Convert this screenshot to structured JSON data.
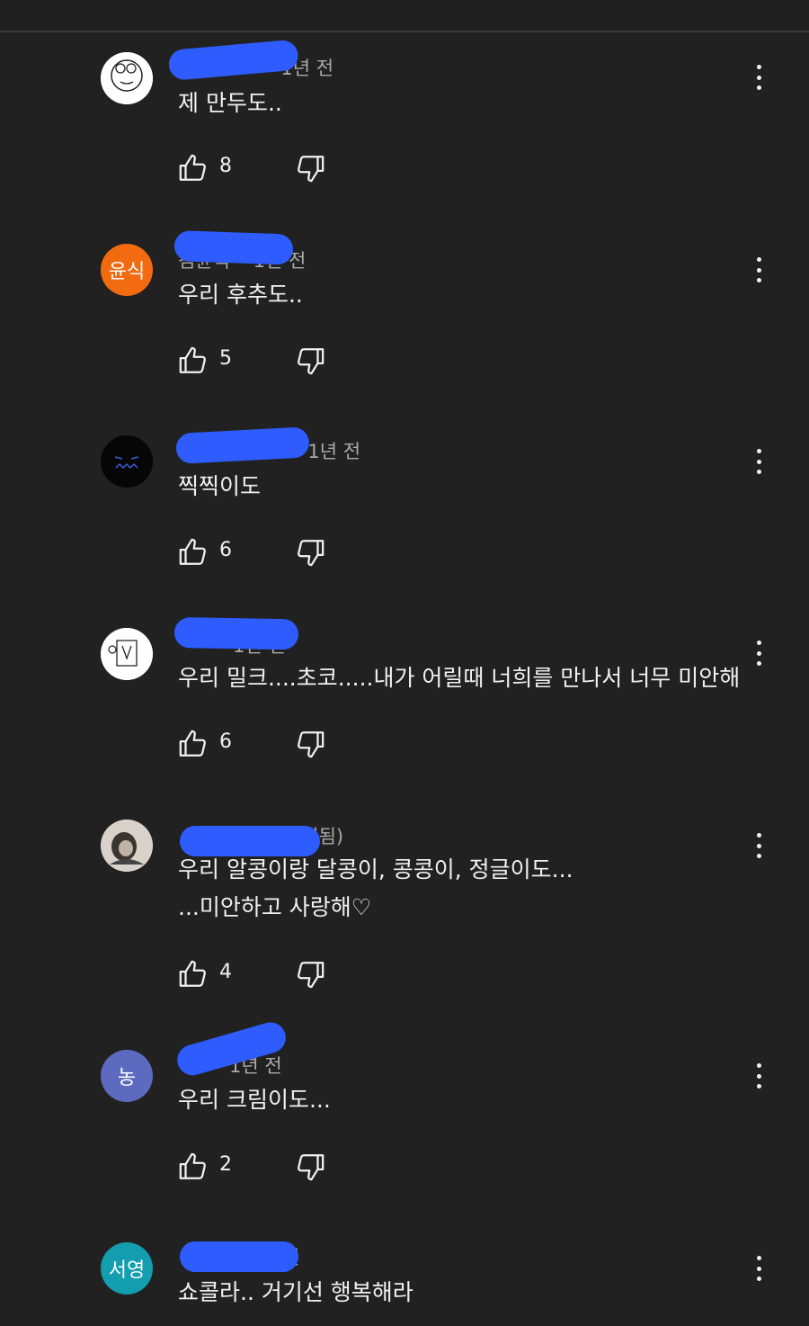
{
  "comments": [
    {
      "meta_visible": "•1년 전",
      "text": "제 만두도..",
      "likes": "8",
      "avatar_kind": "drawing",
      "avatar_letters": ""
    },
    {
      "meta_visible": "김윤식 • 1년 전",
      "text": "우리 후추도..",
      "likes": "5",
      "avatar_kind": "letter",
      "avatar_letters": "윤식",
      "avatar_color": "#f26b11"
    },
    {
      "meta_visible": "•1년 전",
      "text": "찍찍이도",
      "likes": "6",
      "avatar_kind": "dark",
      "avatar_letters": ""
    },
    {
      "meta_visible": "• 1년 전",
      "text": "우리 밀크....초코.....내가 어릴때 너희를 만나서 너무 미안해",
      "likes": "6",
      "avatar_kind": "drawing2",
      "avatar_letters": ""
    },
    {
      "meta_visible": "• 1년 전(수정됨)",
      "text": "우리 알콩이랑 달콩이, 콩콩이, 정글이도...\n...미안하고 사랑해♡",
      "likes": "4",
      "avatar_kind": "photo",
      "avatar_letters": ""
    },
    {
      "meta_visible": "• 1년 전",
      "text": "우리 크림이도...",
      "likes": "2",
      "avatar_kind": "letter",
      "avatar_letters": "농",
      "avatar_color": "#5c6bc0"
    },
    {
      "meta_visible": "전",
      "text": "쇼콜라.. 거기선 행복해라",
      "likes": "",
      "avatar_kind": "letter",
      "avatar_letters": "서영",
      "avatar_color": "#129eaf"
    }
  ],
  "colors": {
    "redaction": "#2e5cff",
    "background": "#212121"
  },
  "icons": {
    "like": "thumbs-up-icon",
    "dislike": "thumbs-down-icon",
    "menu": "more-vert-icon"
  }
}
